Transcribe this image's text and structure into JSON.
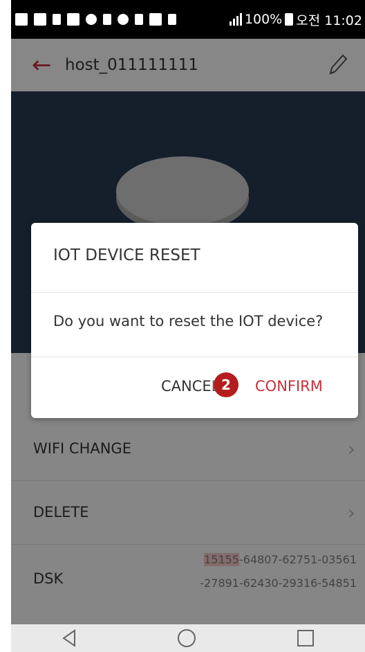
{
  "status_bar": {
    "battery": "100%",
    "time": "오전 11:02"
  },
  "header": {
    "title": "host_011111111",
    "back_icon": "arrow-left-icon",
    "edit_icon": "pencil-icon"
  },
  "menu": [
    {
      "label": "WIFI CHANGE"
    },
    {
      "label": "DELETE"
    }
  ],
  "dsk": {
    "label": "DSK",
    "highlight": "15155",
    "line1_rest": "-64807-62751-03561",
    "line2": "-27891-62430-29316-54851"
  },
  "dialog": {
    "title": "IOT DEVICE RESET",
    "message": "Do you want to reset the IOT device?",
    "cancel_label": "CANCEL",
    "confirm_label": "CONFIRM"
  },
  "step_marker": "2",
  "colors": {
    "accent": "#c4303c",
    "hero_bg": "#273a4f",
    "marker": "#b41d1d"
  }
}
